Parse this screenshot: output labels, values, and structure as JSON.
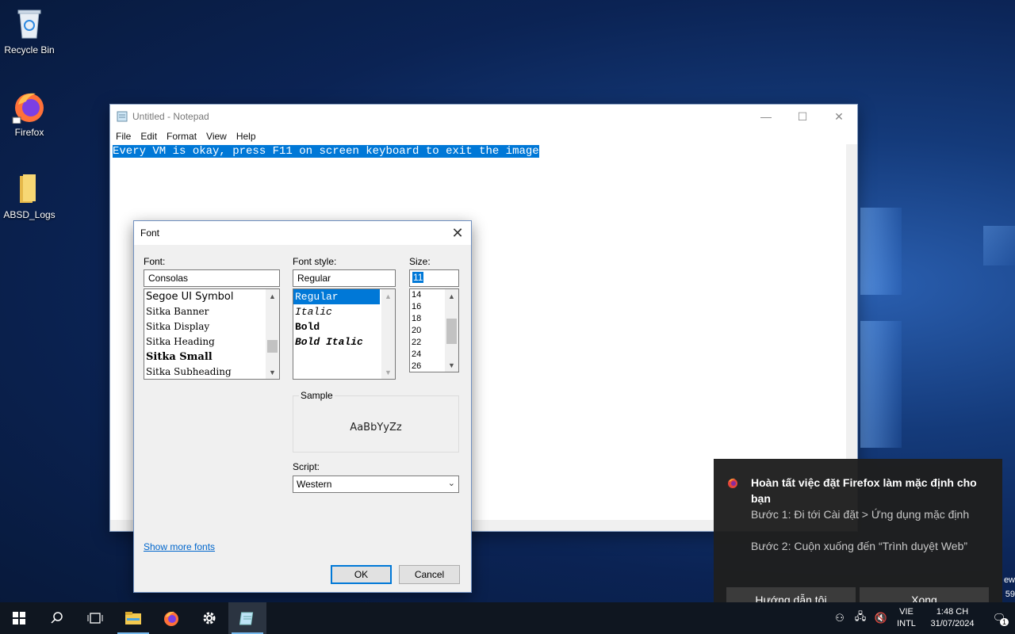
{
  "desktop": {
    "icons": [
      {
        "label": "Recycle Bin",
        "icon": "recycle-bin-icon"
      },
      {
        "label": "Firefox",
        "icon": "firefox-icon"
      },
      {
        "label": "ABSD_Logs",
        "icon": "folder-icon"
      }
    ],
    "edge_text_1": "ew",
    "edge_text_2": "59"
  },
  "notepad": {
    "title": "Untitled - Notepad",
    "menu": [
      "File",
      "Edit",
      "Format",
      "View",
      "Help"
    ],
    "content": "Every VM is okay, press F11 on screen keyboard to exit the image",
    "controls": {
      "minimize": "—",
      "maximize": "☐",
      "close": "✕"
    }
  },
  "font_dialog": {
    "title": "Font",
    "close": "✕",
    "font_label": "Font:",
    "font_value": "Consolas",
    "font_list": [
      "Segoe UI Symbol",
      "Sitka Banner",
      "Sitka Display",
      "Sitka Heading",
      "Sitka Small",
      "Sitka Subheading"
    ],
    "style_label": "Font style:",
    "style_value": "Regular",
    "style_list": [
      "Regular",
      "Italic",
      "Bold",
      "Bold Italic"
    ],
    "style_selected": "Regular",
    "size_label": "Size:",
    "size_value": "11",
    "size_list": [
      "14",
      "16",
      "18",
      "20",
      "22",
      "24",
      "26"
    ],
    "sample_label": "Sample",
    "sample_text": "AaBbYyZz",
    "script_label": "Script:",
    "script_value": "Western",
    "show_more_fonts": "Show more fonts",
    "ok_label": "OK",
    "cancel_label": "Cancel"
  },
  "toast": {
    "title": "Hoàn tất việc đặt Firefox làm mặc định cho bạn",
    "line1": "Bước 1: Đi tới Cài đặt > Ứng dụng mặc định",
    "line2": "Bước 2: Cuộn xuống đến “Trình duyệt Web”",
    "button1": "Hướng dẫn tôi",
    "button2": "Xong"
  },
  "taskbar": {
    "items": [
      "start-icon",
      "search-icon",
      "task-view-icon",
      "file-explorer-icon",
      "firefox-icon",
      "settings-icon",
      "notepad-icon"
    ],
    "lang_line1": "VIE",
    "lang_line2": "INTL",
    "time": "1:48 CH",
    "date": "31/07/2024",
    "notification_count": "1"
  },
  "colors": {
    "accent": "#0078d7",
    "taskbar": "#0f1620",
    "toast_bg": "#1f1f1f"
  }
}
